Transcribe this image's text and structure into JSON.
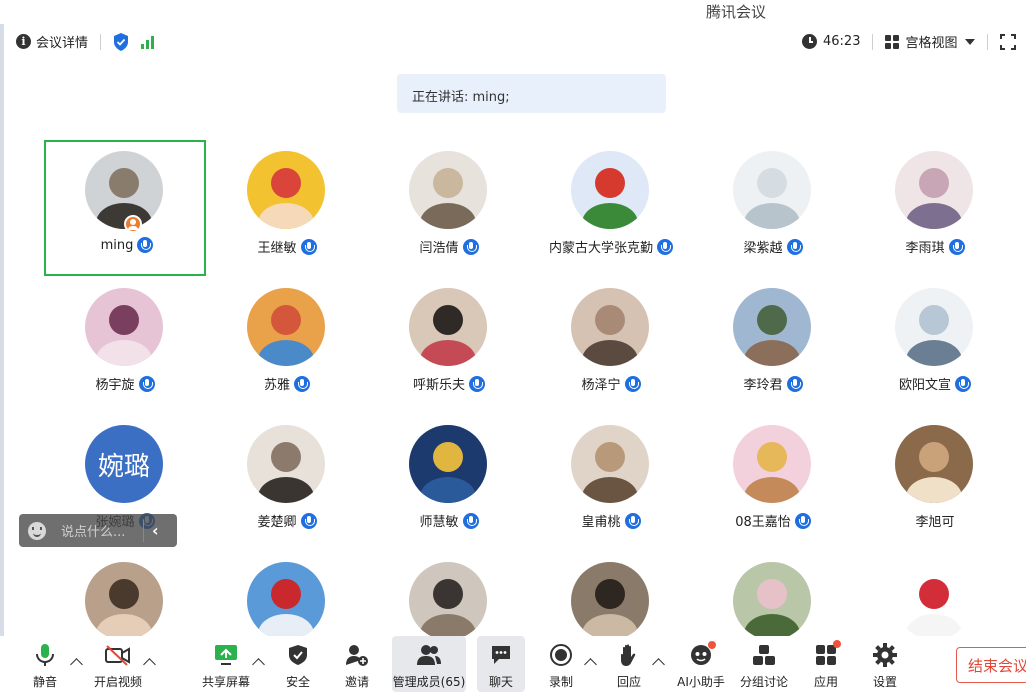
{
  "app": {
    "title": "腾讯会议"
  },
  "toolbar": {
    "meeting_details": "会议详情",
    "timer": "46:23",
    "view_mode": "宫格视图"
  },
  "speaking": {
    "text": "正在讲话: ming;"
  },
  "participants": [
    {
      "name": "ming",
      "active": true,
      "host": true
    },
    {
      "name": "王继敏"
    },
    {
      "name": "闫浩倩"
    },
    {
      "name": "内蒙古大学张克勤"
    },
    {
      "name": "梁紫越"
    },
    {
      "name": "李雨琪"
    },
    {
      "name": "杨宇旋"
    },
    {
      "name": "苏雅"
    },
    {
      "name": "呼斯乐夫"
    },
    {
      "name": "杨泽宁"
    },
    {
      "name": "李玲君"
    },
    {
      "name": "欧阳文宣"
    },
    {
      "name": "张婉璐",
      "avatar_text": "婉璐"
    },
    {
      "name": "姜楚卿"
    },
    {
      "name": "师慧敏"
    },
    {
      "name": "皇甫桃"
    },
    {
      "name": "08王嘉怡"
    },
    {
      "name": "李旭可",
      "muted_mic_hidden": true
    },
    {
      "name": ""
    },
    {
      "name": ""
    },
    {
      "name": ""
    },
    {
      "name": ""
    },
    {
      "name": ""
    },
    {
      "name": ""
    }
  ],
  "chat": {
    "placeholder": "说点什么..."
  },
  "bottom": {
    "mute": "静音",
    "video": "开启视频",
    "share": "共享屏幕",
    "security": "安全",
    "invite": "邀请",
    "members": "管理成员(65)",
    "chat": "聊天",
    "record": "录制",
    "react": "回应",
    "ai": "AI小助手",
    "breakout": "分组讨论",
    "apps": "应用",
    "settings": "设置",
    "end": "结束会议"
  },
  "colors": {
    "accent": "#1f6fe0",
    "active_border": "#2bb24c",
    "signal": "#2bb24c",
    "end": "#e0483a",
    "avatar_text_bg": "#3b6fc4"
  }
}
